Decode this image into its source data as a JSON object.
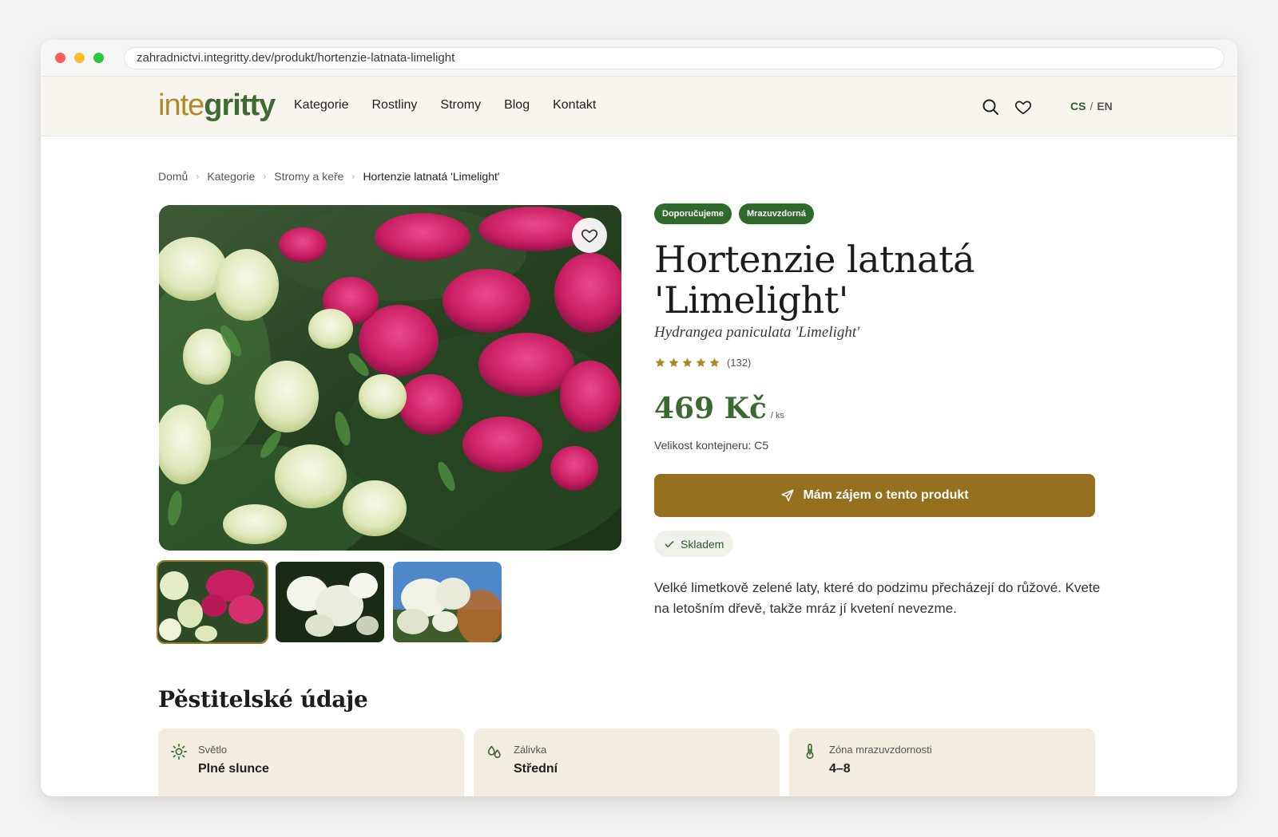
{
  "browser": {
    "url": "zahradnictvi.integritty.dev/produkt/hortenzie-latnata-limelight"
  },
  "header": {
    "logo_part1": "inte",
    "logo_part2": "gritty",
    "nav": [
      "Kategorie",
      "Rostliny",
      "Stromy",
      "Blog",
      "Kontakt"
    ],
    "lang_cs": "CS",
    "lang_sep": "/",
    "lang_en": "EN",
    "icons": [
      "search-icon",
      "heart-icon"
    ]
  },
  "breadcrumb": {
    "items": [
      "Domů",
      "Kategorie",
      "Stromy a keře"
    ],
    "current": "Hortenzie latnatá 'Limelight'"
  },
  "product": {
    "badges": [
      "Doporučujeme",
      "Mrazuvzdorná"
    ],
    "title": "Hortenzie latnatá 'Limelight'",
    "latin_name": "Hydrangea paniculata 'Limelight'",
    "rating_stars": 5,
    "rating_count": "(132)",
    "price": "469 Kč",
    "price_unit": "/ ks",
    "container_size": "Velikost kontejneru: C5",
    "cta_label": "Mám zájem o tento produkt",
    "stock_label": "Skladem",
    "description": "Velké limetkově zelené laty, které do podzimu přecházejí do růžové. Kvete na letošním dřevě, takže mráz jí kvetení nevezme."
  },
  "colors": {
    "accent_green": "#3a6a2f",
    "badge_green": "#2f6a2c",
    "cta_brown": "#95701e",
    "star_gold": "#b08a2a",
    "header_bg": "#f8f5ee",
    "card_bg": "#f2ece1"
  },
  "growing": {
    "title": "Pěstitelské údaje",
    "cards": [
      {
        "icon": "sun-icon",
        "label": "Světlo",
        "value": "Plné slunce"
      },
      {
        "icon": "water-drops-icon",
        "label": "Zálivka",
        "value": "Střední"
      },
      {
        "icon": "thermometer-icon",
        "label": "Zóna mrazuvzdornosti",
        "value": "4–8"
      }
    ]
  }
}
